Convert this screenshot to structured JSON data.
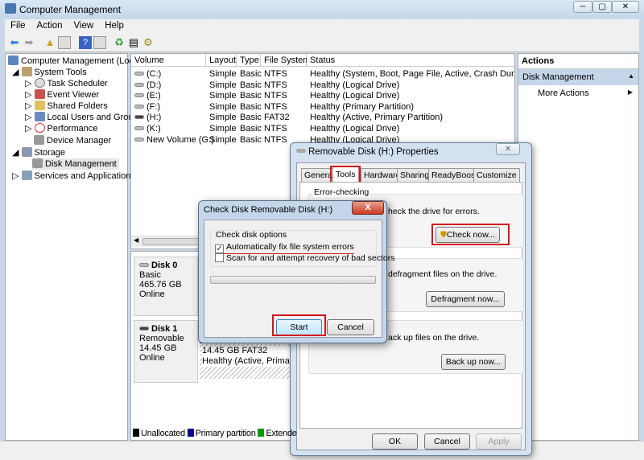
{
  "window": {
    "title": "Computer Management",
    "min": "─",
    "max": "▢",
    "close": "✕"
  },
  "menu": [
    "File",
    "Action",
    "View",
    "Help"
  ],
  "tree": {
    "root": "Computer Management (Local",
    "system_tools": "System Tools",
    "items": [
      "Task Scheduler",
      "Event Viewer",
      "Shared Folders",
      "Local Users and Groups",
      "Performance",
      "Device Manager"
    ],
    "storage": "Storage",
    "disk_mgmt": "Disk Management",
    "services": "Services and Applications"
  },
  "volumes": {
    "headers": [
      "Volume",
      "Layout",
      "Type",
      "File System",
      "Status"
    ],
    "rows": [
      [
        "(C:)",
        "Simple",
        "Basic",
        "NTFS",
        "Healthy (System, Boot, Page File, Active, Crash Dump, Prima"
      ],
      [
        "(D:)",
        "Simple",
        "Basic",
        "NTFS",
        "Healthy (Logical Drive)"
      ],
      [
        "(E:)",
        "Simple",
        "Basic",
        "NTFS",
        "Healthy (Logical Drive)"
      ],
      [
        "(F:)",
        "Simple",
        "Basic",
        "NTFS",
        "Healthy (Primary Partition)"
      ],
      [
        "(H:)",
        "Simple",
        "Basic",
        "FAT32",
        "Healthy (Active, Primary Partition)"
      ],
      [
        "(K:)",
        "Simple",
        "Basic",
        "NTFS",
        "Healthy (Logical Drive)"
      ],
      [
        "New Volume (G:)",
        "Simple",
        "Basic",
        "NTFS",
        "Healthy (Logical Drive)"
      ]
    ]
  },
  "disks": [
    {
      "name": "Disk 0",
      "type": "Basic",
      "size": "465.76 GB",
      "state": "Online"
    },
    {
      "name": "Disk 1",
      "type": "Removable",
      "size": "14.45 GB",
      "state": "Online",
      "part_size": "14.45 GB FAT32",
      "part_status": "Healthy (Active, Primary P"
    }
  ],
  "legend": [
    {
      "label": "Unallocated",
      "color": "#000000"
    },
    {
      "label": "Primary partition",
      "color": "#00008b"
    },
    {
      "label": "Extende",
      "color": "#0a9a0a"
    }
  ],
  "actions": {
    "title": "Actions",
    "section": "Disk Management",
    "more": "More Actions"
  },
  "props": {
    "title": "Removable Disk (H:) Properties",
    "tabs": [
      "General",
      "Tools",
      "Hardware",
      "Sharing",
      "ReadyBoost",
      "Customize"
    ],
    "err_title": "Error-checking",
    "err_text": "heck the drive for errors.",
    "check_btn": "Check now...",
    "defrag_text": "defragment files on the drive.",
    "defrag_btn": "Defragment now...",
    "backup_text": "ack up files on the drive.",
    "backup_btn": "Back up now...",
    "ok": "OK",
    "cancel": "Cancel",
    "apply": "Apply",
    "close": "✕"
  },
  "checkdisk": {
    "title": "Check Disk Removable Disk (H:)",
    "options_title": "Check disk options",
    "opt1": "Automatically fix file system errors",
    "opt1_checked": true,
    "opt2": "Scan for and attempt recovery of bad sectors",
    "opt2_checked": false,
    "progress": 0,
    "start": "Start",
    "cancel": "Cancel",
    "close": "X"
  }
}
